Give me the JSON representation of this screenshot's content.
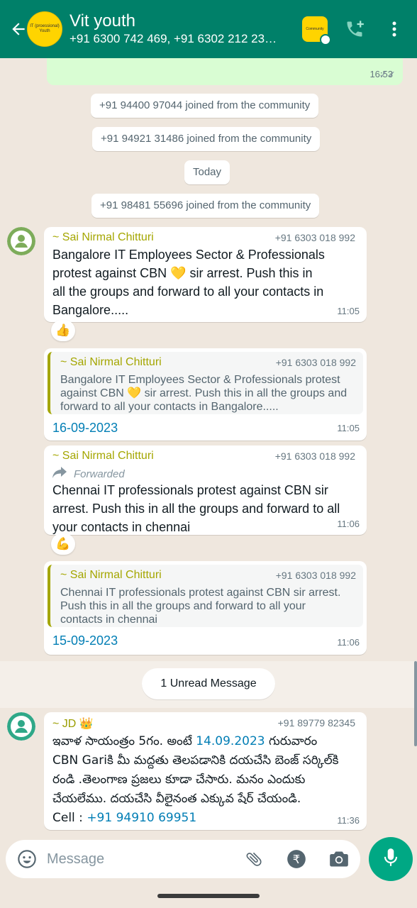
{
  "header": {
    "title": "Vit youth",
    "subtitle": "+91 6300 742 469, +91 6302 212 23…",
    "avatar_text": "IT (proessional) Youth",
    "community_badge_text": "Community"
  },
  "messages": {
    "outgoing_time": "16:53",
    "system": [
      "+91 94400 97044 joined from the community",
      "+91 94921 31486 joined from the community",
      "Today",
      "+91 98481 55696 joined from the community"
    ],
    "m1": {
      "sender": "~ Sai Nirmal Chitturi",
      "phone": "+91 6303 018 992",
      "lines": [
        "Bangalore IT Employees Sector & Professionals",
        "protest against CBN 💛 sir arrest. Push this in",
        "all the groups and forward to all your contacts in",
        "Bangalore....."
      ],
      "time": "11:05",
      "reaction": "👍"
    },
    "m2": {
      "quote_sender": "~ Sai Nirmal Chitturi",
      "quote_phone": "+91 6303 018 992",
      "quote_lines": [
        "Bangalore IT Employees Sector & Professionals protest",
        "against CBN 💛 sir arrest. Push this in all the groups and",
        "forward to all your contacts in Bangalore....."
      ],
      "date": "16-09-2023",
      "time": "11:05"
    },
    "m3": {
      "sender": "~ Sai Nirmal Chitturi",
      "phone": "+91 6303 018 992",
      "forwarded": "Forwarded",
      "lines": [
        "Chennai IT professionals protest against CBN sir",
        "arrest. Push this in all the groups and forward to all",
        "your contacts in chennai"
      ],
      "time": "11:06",
      "reaction": "💪"
    },
    "m4": {
      "quote_sender": "~ Sai Nirmal Chitturi",
      "quote_phone": "+91 6303 018 992",
      "quote_lines": [
        "Chennai IT professionals protest against CBN sir arrest.",
        "Push this in all the groups and forward to all your",
        "contacts in chennai"
      ],
      "date": "15-09-2023",
      "time": "11:06"
    },
    "unread": "1 Unread Message",
    "m5": {
      "sender": "~ JD 👑",
      "phone": "+91 89779 82345",
      "line1_a": "ఇవాళ సాయంత్రం 5గం. అంటే ",
      "line1_link": "14.09.2023",
      "line1_b": " గురువారం",
      "line2": "CBN Gariకి మీ మద్దతు తెలపడానికి దయచేసి బెంజ్ సర్కిల్‌కి",
      "line3": "రండి .తెలంగాణ ప్రజలు కూడా చేసారు. మనం ఎందుకు",
      "line4": "చేయలేము. దయచేసి వీలైనంత ఎక్కువ షేర్ చేయండి.",
      "cell_label": "Cell : ",
      "cell_number": "+91 94910 69951",
      "time": "11:36"
    }
  },
  "composer": {
    "placeholder": "Message"
  },
  "colors": {
    "header": "#008069",
    "accent": "#00a884",
    "sender": "#a4a600",
    "link": "#027eb5"
  }
}
